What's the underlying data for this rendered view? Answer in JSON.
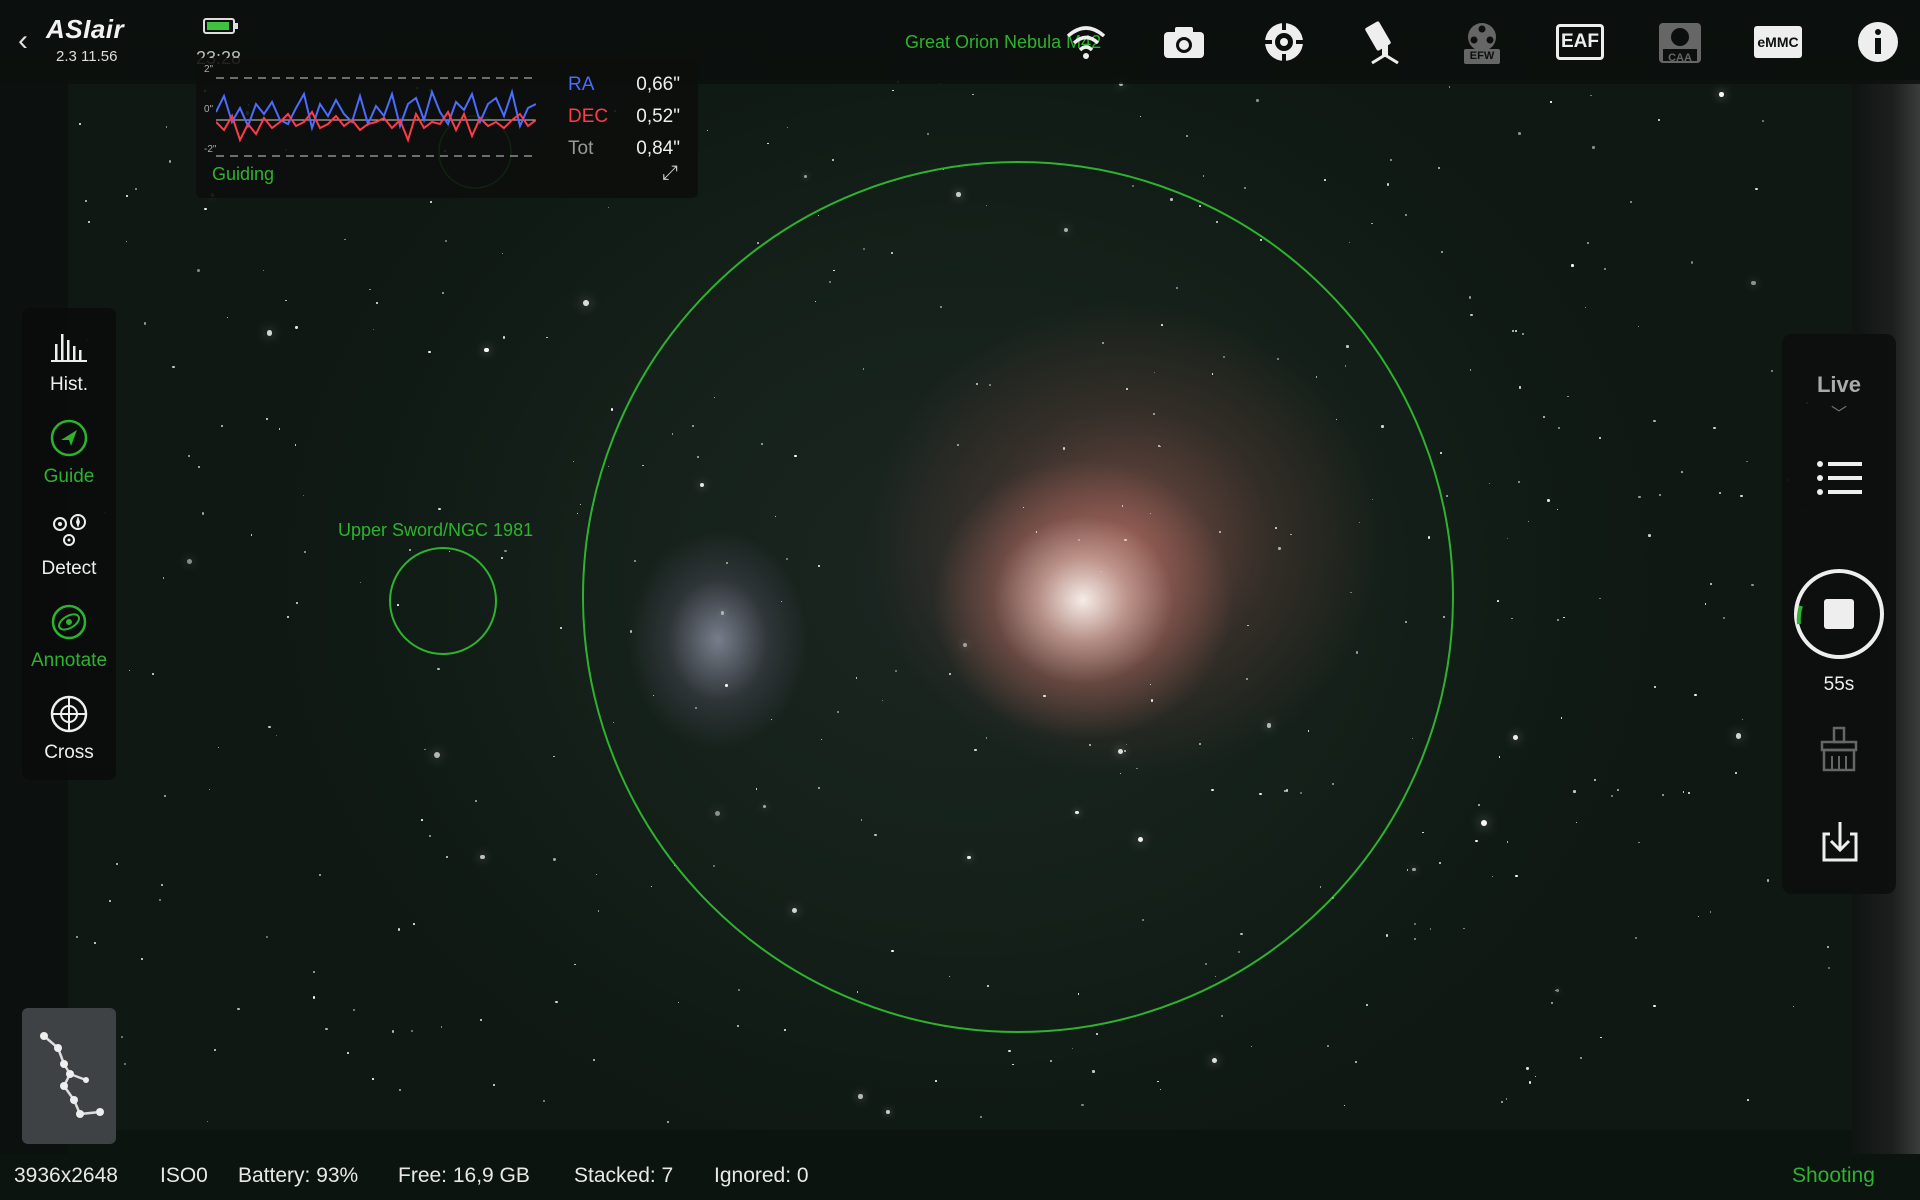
{
  "app": {
    "logo": "ASIair",
    "version": "2.3 11.56",
    "clock": "23:28"
  },
  "annotations": {
    "main_target": "Great Orion Nebula M42",
    "secondary_target": "Upper Sword/NGC 1981"
  },
  "top_icons": [
    {
      "name": "wifi-icon",
      "label": ""
    },
    {
      "name": "camera-icon",
      "label": ""
    },
    {
      "name": "guide-scope-icon",
      "label": ""
    },
    {
      "name": "telescope-mount-icon",
      "label": ""
    },
    {
      "name": "efw-icon",
      "label": "EFW"
    },
    {
      "name": "eaf-icon",
      "label": "EAF"
    },
    {
      "name": "caa-icon",
      "label": "CAA"
    },
    {
      "name": "emmc-icon",
      "label": "eMMC"
    },
    {
      "name": "info-icon",
      "label": ""
    }
  ],
  "guiding": {
    "axis_top": "2\"",
    "axis_mid": "0\"",
    "axis_bot": "-2\"",
    "ra_label": "RA",
    "ra_value": "0,66\"",
    "dec_label": "DEC",
    "dec_value": "0,52\"",
    "tot_label": "Tot",
    "tot_value": "0,84\"",
    "status": "Guiding",
    "colors": {
      "ra": "#4a6cff",
      "dec": "#ff3a4a",
      "status": "#2fb22f"
    }
  },
  "left_tools": [
    {
      "name": "hist",
      "label": "Hist.",
      "active": false
    },
    {
      "name": "guide",
      "label": "Guide",
      "active": true
    },
    {
      "name": "detect",
      "label": "Detect",
      "active": false
    },
    {
      "name": "annotate",
      "label": "Annotate",
      "active": true
    },
    {
      "name": "cross",
      "label": "Cross",
      "active": false
    }
  ],
  "right_panel": {
    "mode": "Live",
    "countdown": "55s"
  },
  "status_bar": {
    "resolution": "3936x2648",
    "iso": "ISO0",
    "battery": "Battery: 93%",
    "free": "Free: 16,9 GB",
    "stacked": "Stacked: 7",
    "ignored": "Ignored: 0",
    "state": "Shooting"
  },
  "accent_color": "#2fb22f"
}
